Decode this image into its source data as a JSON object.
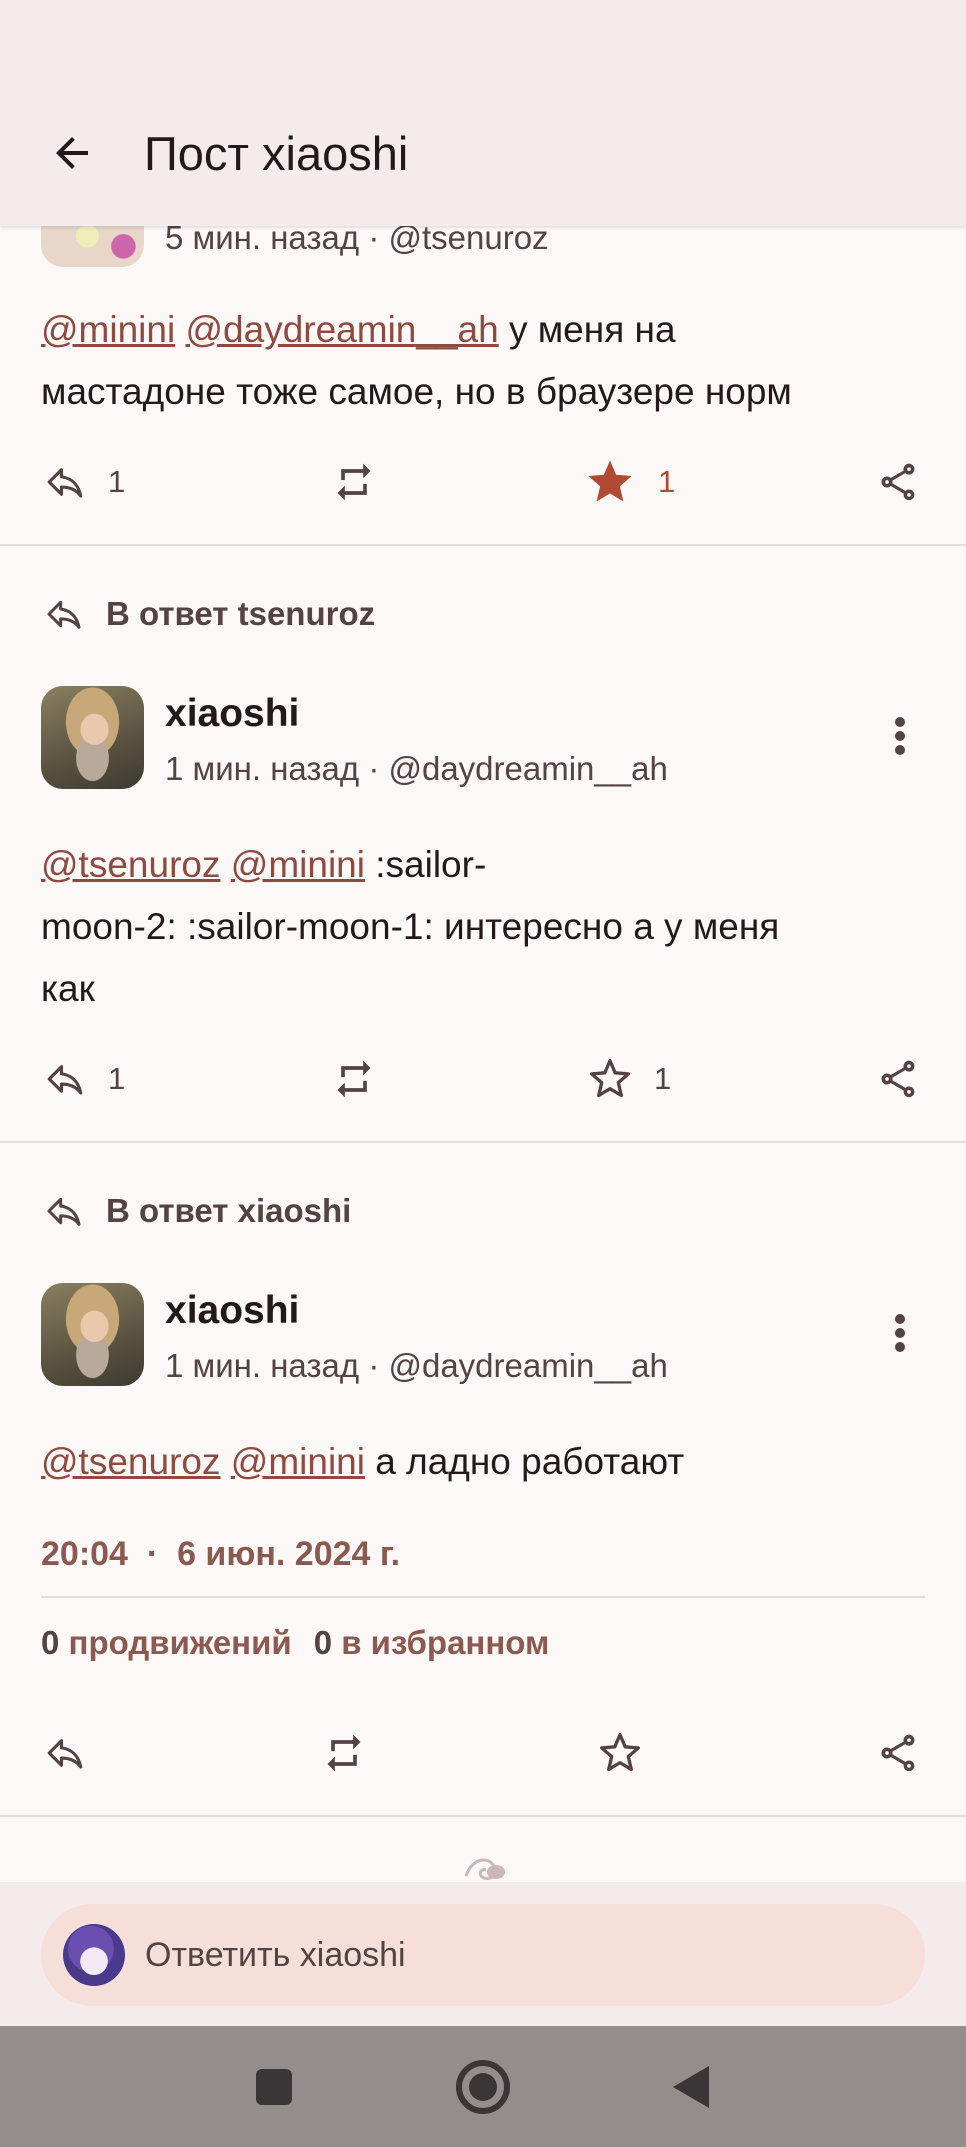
{
  "app_bar": {
    "title": "Пост xiaoshi"
  },
  "posts": [
    {
      "meta": "5 мин. назад · @tsenuroz",
      "mentions": [
        "@minini",
        "@daydreamin__ah"
      ],
      "text_line1": " у меня на",
      "text_line2": "мастадоне тоже самое, но в браузере норм",
      "replies": "1",
      "favourites": "1",
      "favourited": true
    },
    {
      "reply_to": "В ответ tsenuroz",
      "author": "xiaoshi",
      "meta": "1 мин. назад · @daydreamin__ah",
      "mentions": [
        "@tsenuroz",
        "@minini"
      ],
      "text_line1": " :sailor-",
      "text_line2": "moon-2: :sailor-moon-1: интересно а у меня",
      "text_line3": "как",
      "replies": "1",
      "favourites": "1"
    },
    {
      "reply_to": "В ответ xiaoshi",
      "author": "xiaoshi",
      "meta": "1 мин. назад · @daydreamin__ah",
      "mentions": [
        "@tsenuroz",
        "@minini"
      ],
      "text_line1": " а ладно работают",
      "time": "20:04",
      "date": "6 июн. 2024 г.",
      "boosts_count": "0",
      "boosts_label": "продвижений",
      "favs_count": "0",
      "favs_label": "в избранном"
    }
  ],
  "reply_bar": {
    "placeholder": "Ответить xiaoshi"
  },
  "colors": {
    "accent": "#b04a33",
    "mention": "#8f4a40",
    "surface": "#fdf8f8",
    "bar": "#f4ecec"
  }
}
